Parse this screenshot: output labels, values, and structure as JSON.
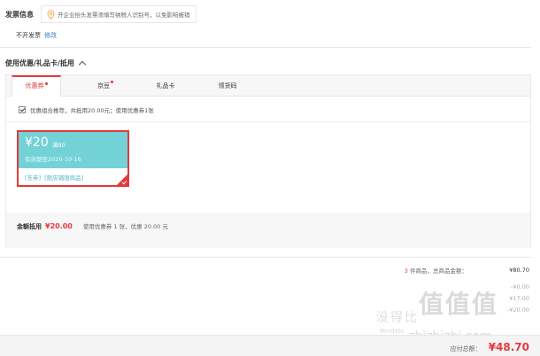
{
  "invoice": {
    "title": "发票信息",
    "tip": "开企业抬头发票须填写纳税人识别号，以免影响报销",
    "status": "不开发票",
    "edit": "修改"
  },
  "coupons": {
    "header": "使用优惠/礼品卡/抵用",
    "tabs": [
      {
        "label": "优惠券",
        "dot": true
      },
      {
        "label": "京豆",
        "dot": true
      },
      {
        "label": "礼品卡",
        "dot": false
      },
      {
        "label": "领货码",
        "dot": false
      }
    ],
    "combo_text": "优惠组合推荐，共抵用20.00元；使用优惠券1张",
    "card": {
      "amount": "¥20",
      "condition": "满80",
      "expiry": "有效期至2020-10-16",
      "tag1": "[东券]",
      "tag2": "[限店铺限商品]"
    },
    "discount": {
      "label": "金额抵用",
      "amount": "¥20.00",
      "detail": "使用优惠券 1 张，优惠 20.00 元"
    }
  },
  "summary": {
    "items_count": "3",
    "items_label_suffix": "件商品，总商品金额：",
    "items_value": "¥80.70",
    "row2_value": "-¥0.00",
    "row3_value": "¥17.00",
    "row4_value": "-¥20.00",
    "total_label": "应付总额：",
    "total_value": "¥48.70"
  },
  "watermark": {
    "cn": "没得比",
    "big": "值值值",
    "small": "Meidebi",
    "en": "zhizhizhi.com"
  },
  "colors": {
    "accent": "#e4393c",
    "coupon": "#73d2d6",
    "link": "#2f7ac9"
  }
}
